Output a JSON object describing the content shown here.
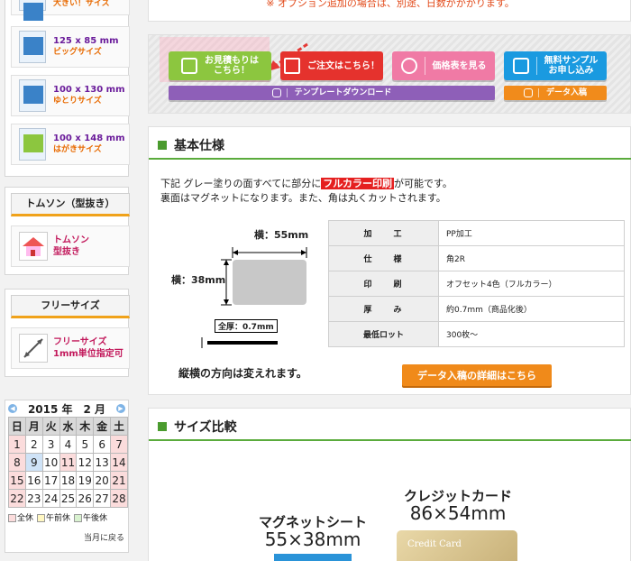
{
  "sidebar": {
    "top_cut_label": "大きい！サイズ",
    "products": [
      {
        "size": "125 x 85 mm",
        "name": "ビッグサイズ"
      },
      {
        "size": "100 x 130 mm",
        "name": "ゆとりサイズ"
      },
      {
        "size": "100 x 148 mm",
        "name": "はがきサイズ"
      }
    ],
    "thomson": {
      "title": "トムソン（型抜き）",
      "link_line1": "トムソン",
      "link_line2": "型抜き"
    },
    "free_size": {
      "title": "フリーサイズ",
      "link_line1": "フリーサイズ",
      "link_line2": "1mm単位指定可"
    },
    "calendar": {
      "title": "2015 年　2 月",
      "weekdays": [
        "日",
        "月",
        "火",
        "水",
        "木",
        "金",
        "土"
      ],
      "weeks": [
        [
          "1",
          "2",
          "3",
          "4",
          "5",
          "6",
          "7"
        ],
        [
          "8",
          "9",
          "10",
          "11",
          "12",
          "13",
          "14"
        ],
        [
          "15",
          "16",
          "17",
          "18",
          "19",
          "20",
          "21"
        ],
        [
          "22",
          "23",
          "24",
          "25",
          "26",
          "27",
          "28"
        ]
      ],
      "legend": {
        "holiday": "全休",
        "am_off": "午前休",
        "pm_off": "午後休"
      },
      "back_label": "当月に戻る",
      "colors": {
        "holiday": "#fbdcdc",
        "today": "#cfe3f7"
      }
    }
  },
  "main": {
    "notice": "※ オプション追加の場合は、別途、日数がかかります。",
    "buttons": {
      "estimate_line1": "お見積もりは",
      "estimate_line2": "こちら！",
      "order": "ご注文はこちら！",
      "price": "価格表を見る",
      "sample_line1": "無料サンプル",
      "sample_line2": "お申し込み",
      "template": "テンプレートダウンロード",
      "data": "データ入稿"
    },
    "spec": {
      "title": "基本仕様",
      "text_line1_before": "下記 グレー塗りの面すべてに部分に",
      "text_line1_highlight": "フルカラー印刷",
      "text_line1_after": "が可能です。",
      "text_line2": "裏面はマグネットになります。また、角は丸くカットされます。",
      "diagram": {
        "width_label": "横：55mm",
        "height_label": "横：38mm",
        "thickness_label": "全厚：0.7mm"
      },
      "table": [
        {
          "key": "加　　工",
          "value": "PP加工"
        },
        {
          "key": "仕　　様",
          "value": "角2R"
        },
        {
          "key": "印　　刷",
          "value": "オフセット4色（フルカラー）"
        },
        {
          "key": "厚　　み",
          "value": "約0.7mm（商品化後）"
        },
        {
          "key": "最低ロット",
          "value": "300枚～"
        }
      ],
      "note": "縦横の方向は変えれます。",
      "detail_button": "データ入稿の詳細はこちら"
    },
    "compare": {
      "title": "サイズ比較",
      "magnet_title": "マグネットシート",
      "magnet_size": "55×38mm",
      "card_title": "クレジットカード",
      "card_size": "86×54mm",
      "card_text": "Credit Card"
    }
  }
}
